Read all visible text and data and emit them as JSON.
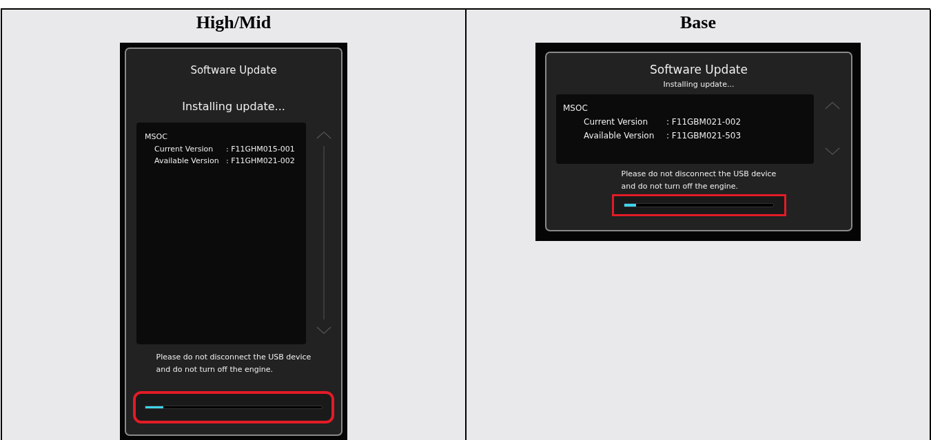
{
  "columns": [
    {
      "heading": "High/Mid",
      "screen": {
        "kind": "portrait",
        "title": "Software Update",
        "status": "Installing update...",
        "module": "MSOC",
        "versions": [
          {
            "label": "Current Version",
            "value": ": F11GHM015-001"
          },
          {
            "label": "Available Version",
            "value": ": F11GHM021-002"
          }
        ],
        "message": [
          "Please do not disconnect the USB device",
          "and do not turn off the engine."
        ],
        "progress": {
          "level": 0.1
        }
      }
    },
    {
      "heading": "Base",
      "screen": {
        "kind": "landscape",
        "title": "Software Update",
        "status": "Installing update...",
        "module": "MSOC",
        "versions": [
          {
            "label": "Current Version",
            "value": ": F11GBM021-002"
          },
          {
            "label": "Available Version",
            "value": ": F11GBM021-503"
          }
        ],
        "message": [
          "Please do not disconnect the USB device",
          "and do not turn off the engine."
        ],
        "progress": {
          "level": 0.08
        }
      }
    }
  ]
}
